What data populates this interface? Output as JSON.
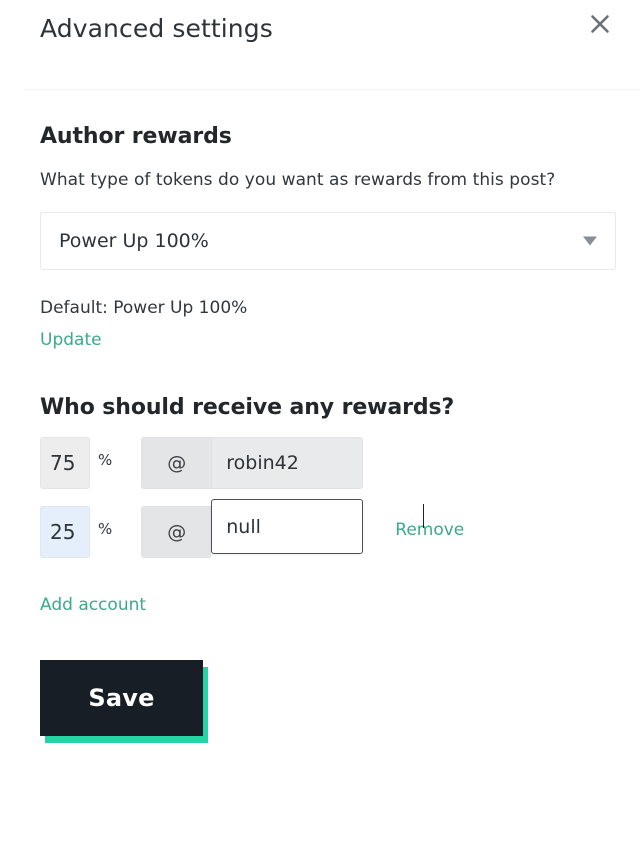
{
  "header": {
    "title": "Advanced settings",
    "close_icon": "close-icon"
  },
  "author_rewards": {
    "heading": "Author rewards",
    "question": "What type of tokens do you want as rewards from this post?",
    "reward_select": {
      "value": "Power Up 100%",
      "caret_icon": "chevron-down-icon"
    },
    "default_label": "Default: Power Up 100%",
    "update_link": "Update"
  },
  "beneficiaries": {
    "heading": "Who should receive any rewards?",
    "percent_symbol": "%",
    "at_symbol": "@",
    "rows": [
      {
        "percent": "75",
        "account": "robin42",
        "account_placeholder": "",
        "remove_label": "",
        "state": "disabled"
      },
      {
        "percent": "25",
        "account": "null",
        "account_placeholder": "",
        "remove_label": "Remove",
        "state": "editing"
      }
    ],
    "add_account_link": "Add account"
  },
  "footer": {
    "save_label": "Save"
  },
  "colors": {
    "accent_teal": "#3aa98c",
    "button_shadow_green": "#25d3a5",
    "button_dark": "#171e25",
    "autofill_blue": "#e5effb",
    "disabled_gray": "#e9eaeb"
  }
}
